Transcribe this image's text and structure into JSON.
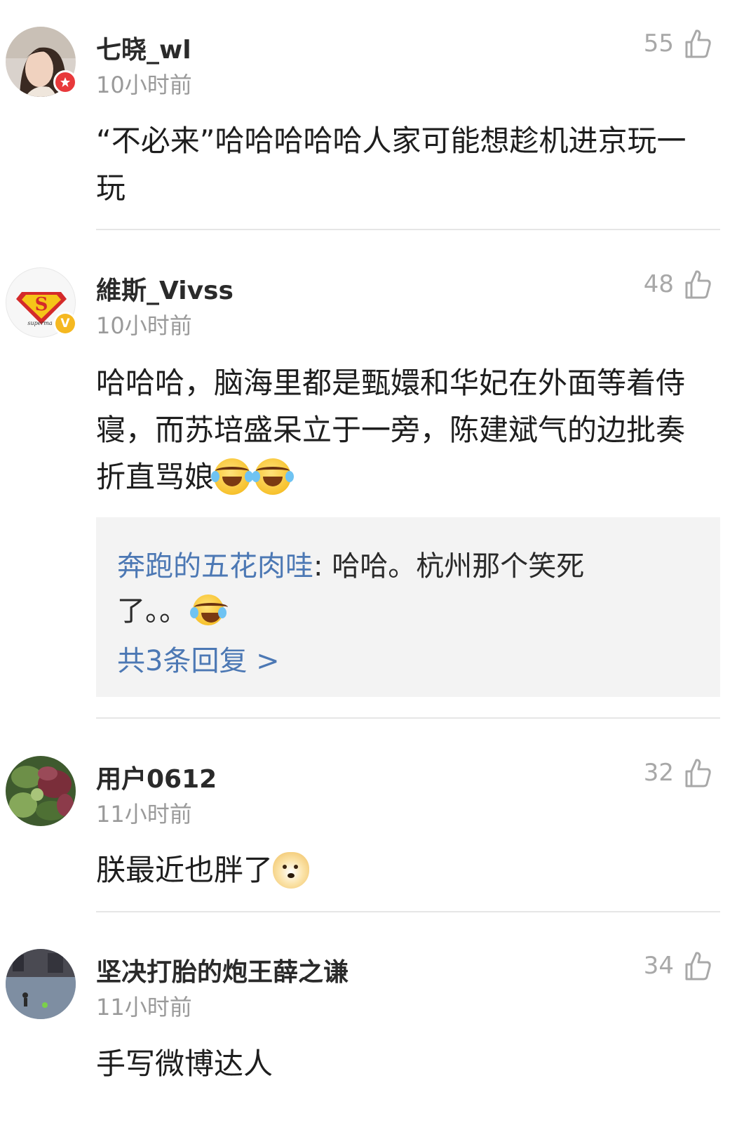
{
  "comments": [
    {
      "username": "七晓_wl",
      "time": "10小时前",
      "likes": "55",
      "text": "“不必来”哈哈哈哈哈人家可能想趁机进京玩一玩",
      "badge_color": "#e8393b",
      "badge_icon": "star-icon"
    },
    {
      "username": "維斯_Vivss",
      "time": "10小时前",
      "likes": "48",
      "text": "哈哈哈，脑海里都是甄嬛和华妃在外面等着侍寝，而苏培盛呆立于一旁，陈建斌气的边批奏折直骂娘",
      "badge_color": "#f5b820",
      "badge_icon": "verified-v-icon",
      "badge_text": "V",
      "emojis": [
        "laugh-cry-emoji",
        "laugh-cry-emoji"
      ],
      "reply": {
        "author": "奔跑的五花肉哇",
        "separator": ": ",
        "text": "哈哈。杭州那个笑死了。。",
        "emoji": "laugh-cry-emoji",
        "more": "共3条回复 >"
      }
    },
    {
      "username": "用户0612",
      "time": "11小时前",
      "likes": "32",
      "text": "朕最近也胖了",
      "emoji": "doge-emoji"
    },
    {
      "username": "坚决打胎的炮王薛之谦",
      "time": "11小时前",
      "likes": "34",
      "text": "手写微博达人"
    }
  ],
  "colors": {
    "link_blue": "#4c78b4",
    "meta_gray": "#9a9a9a",
    "divider": "#e6e6e6",
    "reply_bg": "#f3f3f3"
  }
}
